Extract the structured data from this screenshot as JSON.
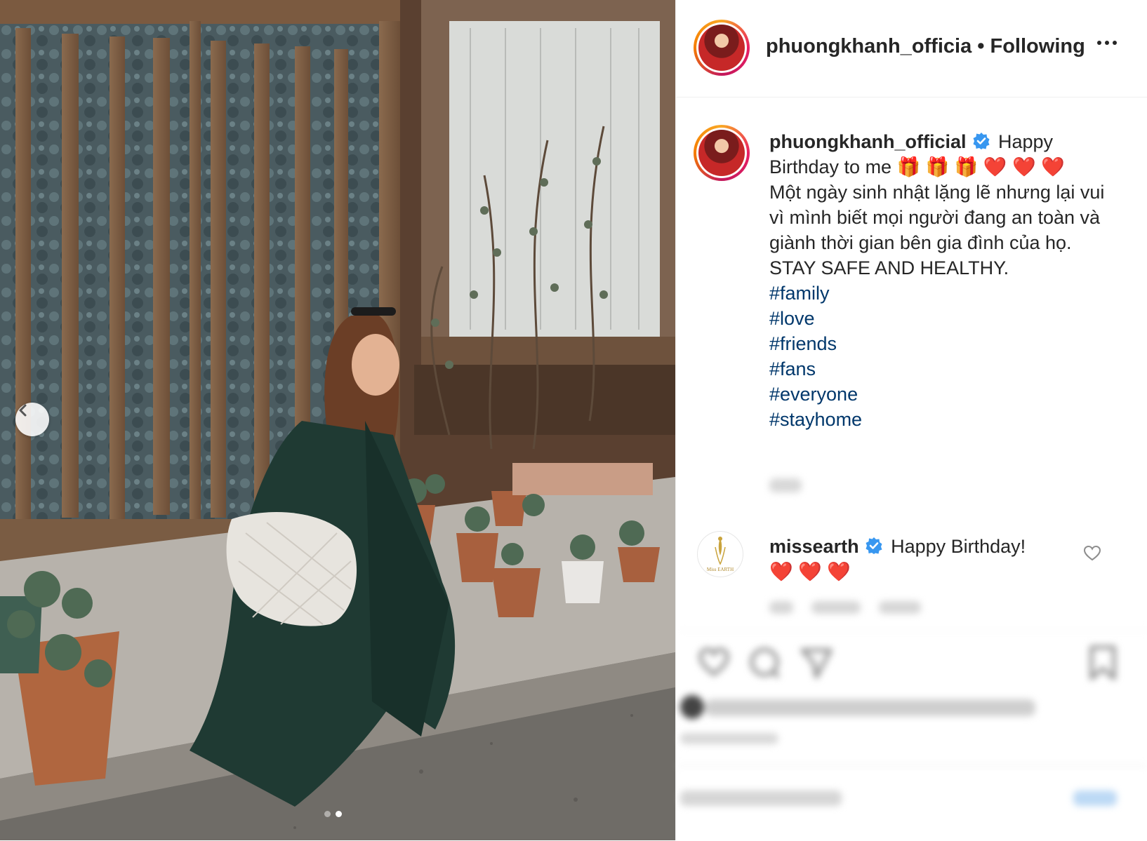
{
  "post": {
    "username": "phuongkhanh_official",
    "header_username": "phuongkhanh_officia",
    "header_separator": "•",
    "follow_status": "Following",
    "more_icon": "more-options-icon",
    "verified_icon": "verified-badge-icon",
    "caption": {
      "first_line_rest": "Happy Birthday to me 🎁 🎁 🎁 ❤️ ❤️ ❤️",
      "lines": [
        "Một ngày sinh nhật lặng lẽ nhưng lại vui vì mình biết mọi người đang an toàn và giành thời gian bên gia đình của họ.",
        "STAY SAFE AND HEALTHY."
      ],
      "hashtags": [
        "#family",
        "#love",
        "#friends",
        "#fans",
        "#everyone",
        "#stayhome"
      ]
    }
  },
  "comment": {
    "username": "missearth",
    "text": "Happy Birthday!",
    "hearts": "❤️ ❤️ ❤️",
    "avatar_label": "Miss EARTH"
  },
  "carousel": {
    "prev_icon": "chevron-left-icon",
    "slide_count": 2,
    "active_slide": 2
  },
  "colors": {
    "hashtag": "#00376b",
    "verified": "#3897f0",
    "text": "#262626",
    "border": "#efefef"
  }
}
